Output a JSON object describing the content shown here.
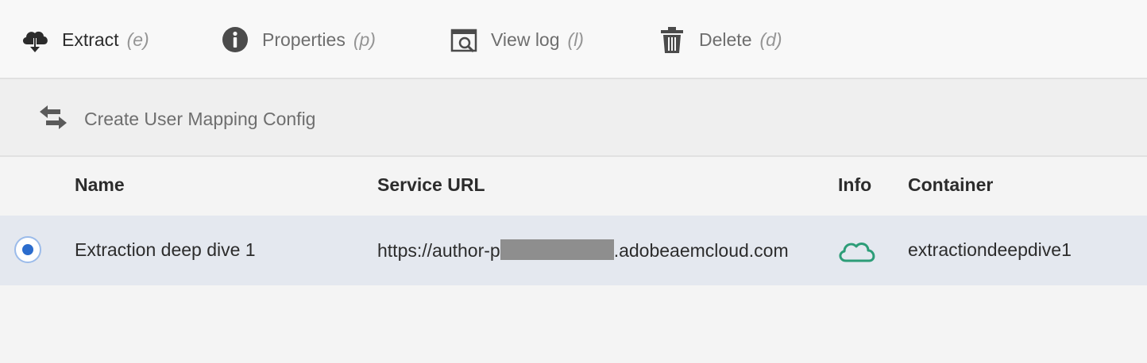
{
  "toolbar": {
    "buttons": [
      {
        "label": "Extract",
        "shortcut": "(e)",
        "icon": "cloud-download-icon"
      },
      {
        "label": "Properties",
        "shortcut": "(p)",
        "icon": "info-icon"
      },
      {
        "label": "View log",
        "shortcut": "(l)",
        "icon": "view-log-icon"
      },
      {
        "label": "Delete",
        "shortcut": "(d)",
        "icon": "trash-icon"
      }
    ]
  },
  "actionbar": {
    "create_label": "Create User Mapping Config",
    "icon": "swap-arrows-icon"
  },
  "table": {
    "headers": {
      "name": "Name",
      "service_url": "Service URL",
      "info": "Info",
      "container": "Container"
    },
    "rows": [
      {
        "selected": true,
        "name": "Extraction deep dive 1",
        "service_url_prefix": "https://author-p",
        "service_url_suffix": ".adobeaemcloud.com",
        "info_icon": "cloud-icon",
        "container": "extractiondeepdive1"
      }
    ]
  },
  "colors": {
    "accent": "#2b6ccd",
    "selected_row": "#e4e8ef",
    "cloud_status": "#2d9d78",
    "icon_gray": "#4b4b4b"
  }
}
